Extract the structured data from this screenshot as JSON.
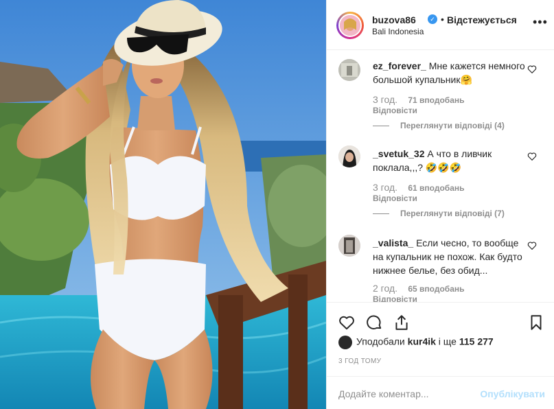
{
  "header": {
    "username": "buzova86",
    "dot": "•",
    "follow_label": "Відстежується",
    "location": "Bali Indonesia",
    "more_label": "•••"
  },
  "comments": [
    {
      "user": "ez_forever_",
      "text": "Мне кажется немного большой купальник🤗",
      "time": "3 год.",
      "likes": "71 вподобань",
      "reply_label": "Відповісти",
      "view_replies": "Переглянути відповіді (4)"
    },
    {
      "user": "_svetuk_32",
      "text": "А что в ливчик поклала,,,? 🤣🤣🤣",
      "time": "3 год.",
      "likes": "61 вподобань",
      "reply_label": "Відповісти",
      "view_replies": "Переглянути відповіді (7)"
    },
    {
      "user": "_valista_",
      "text": "Если чесно, то вообще на купальник не похож. Как будто нижнее белье, без обид...",
      "time": "2 год.",
      "likes": "65 вподобань",
      "reply_label": "Відповісти"
    }
  ],
  "likes": {
    "prefix": "Уподобали",
    "user": "kur4ik",
    "connector": "і ще",
    "count": "115 277"
  },
  "timestamp": "3 ГОД ТОМУ",
  "add_comment": {
    "placeholder": "Додайте коментар...",
    "publish_label": "Опублікувати"
  },
  "colors": {
    "accent": "#3897f0",
    "publish_disabled": "#b2dffc",
    "meta_gray": "#8e8e8e",
    "border": "#efefef"
  },
  "icons": {
    "verified": "verified-badge-icon",
    "more": "more-options-icon",
    "comment_like": "heart-outline-icon",
    "like": "heart-icon",
    "comment": "comment-bubble-icon",
    "share": "share-icon",
    "save": "bookmark-icon"
  }
}
